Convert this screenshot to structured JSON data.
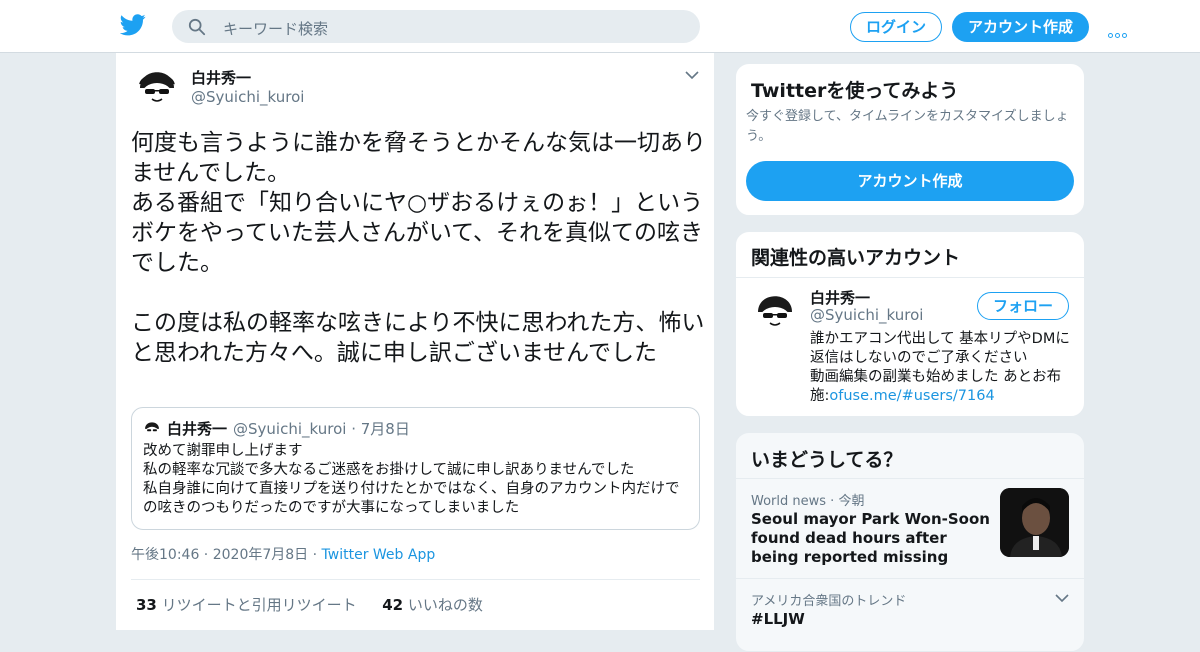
{
  "header": {
    "search_placeholder": "キーワード検索",
    "login_label": "ログイン",
    "signup_label": "アカウント作成"
  },
  "tweet": {
    "author_name": "白井秀一",
    "author_handle": "@Syuichi_kuroi",
    "text": "何度も言うように誰かを脅そうとかそんな気は一切ありませんでした。\nある番組で「知り合いにヤ○ザおるけぇのぉ！」というボケをやっていた芸人さんがいて、それを真似ての呟きでした。\n\nこの度は私の軽率な呟きにより不快に思われた方、怖いと思われた方々へ。誠に申し訳ございませんでした",
    "quote": {
      "author_name": "白井秀一",
      "author_handle": "@Syuichi_kuroi",
      "date": "7月8日",
      "text": "改めて謝罪申し上げます\n私の軽率な冗談で多大なるご迷惑をお掛けして誠に申し訳ありませんでした\n私自身誰に向けて直接リプを送り付けたとかではなく、自身のアカウント内だけでの呟きのつもりだったのですが大事になってしまいました"
    },
    "time": "午後10:46",
    "date": "2020年7月8日",
    "client": "Twitter Web App",
    "retweet_count": "33",
    "retweet_label": "リツイートと引用リツイート",
    "like_count": "42",
    "like_label": "いいねの数"
  },
  "signup_panel": {
    "title": "Twitterを使ってみよう",
    "subtitle": "今すぐ登録して、タイムラインをカスタマイズしましょう。",
    "button_label": "アカウント作成"
  },
  "related_panel": {
    "title": "関連性の高いアカウント",
    "account_name": "白井秀一",
    "account_handle": "@Syuichi_kuroi",
    "follow_label": "フォロー",
    "bio": "誰かエアコン代出して 基本リプやDMに返信はしないのでご了承ください\n動画編集の副業も始めました あとお布施:",
    "bio_link": "ofuse.me/#users/7164"
  },
  "trends_panel": {
    "title": "いまどうしてる？",
    "news_category": "World news",
    "news_time": "今朝",
    "news_title": "Seoul mayor Park Won-Soon found dead hours after being reported missing",
    "trend_location": "アメリカ合衆国のトレンド",
    "trend_tag": "#LLJW"
  },
  "colors": {
    "accent": "#1da1f2",
    "background": "#e6ecf0",
    "secondary_text": "#657786"
  }
}
